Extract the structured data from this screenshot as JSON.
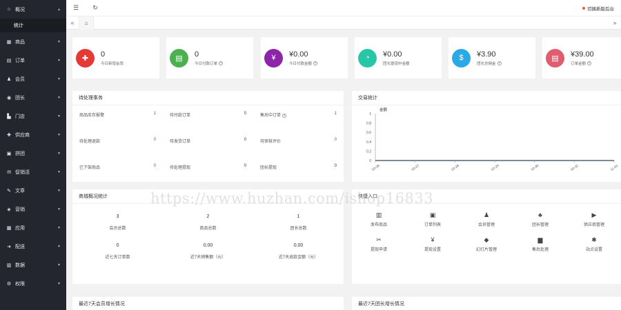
{
  "topbar": {
    "right_text": "切换新版后台"
  },
  "sidebar": {
    "items": [
      {
        "label": "概况",
        "icon": "home-icon",
        "glyph": "⌂",
        "expanded": true
      },
      {
        "label": "统计",
        "sub": true
      },
      {
        "label": "商品",
        "icon": "box-icon",
        "glyph": "▦"
      },
      {
        "label": "订单",
        "icon": "order-icon",
        "glyph": "▤"
      },
      {
        "label": "会员",
        "icon": "user-icon",
        "glyph": "♟"
      },
      {
        "label": "团长",
        "icon": "leader-icon",
        "glyph": "◉"
      },
      {
        "label": "门店",
        "icon": "store-icon",
        "glyph": "▙"
      },
      {
        "label": "供应商",
        "icon": "supplier-icon",
        "glyph": "✚"
      },
      {
        "label": "拼团",
        "icon": "group-icon",
        "glyph": "▣"
      },
      {
        "label": "促销活",
        "icon": "promo-icon",
        "glyph": "✉"
      },
      {
        "label": "文章",
        "icon": "article-icon",
        "glyph": "✎"
      },
      {
        "label": "营销",
        "icon": "marketing-icon",
        "glyph": "◈"
      },
      {
        "label": "应用",
        "icon": "app-icon",
        "glyph": "▩"
      },
      {
        "label": "配送",
        "icon": "delivery-icon",
        "glyph": "➜"
      },
      {
        "label": "数据",
        "icon": "data-icon",
        "glyph": "▥"
      },
      {
        "label": "权限",
        "icon": "permission-icon",
        "glyph": "⚙"
      }
    ]
  },
  "stats": [
    {
      "value": "0",
      "label": "今日新增会员",
      "help": false,
      "color": "#e53935",
      "icon": "user-add-icon",
      "glyph": "✚"
    },
    {
      "value": "0",
      "label": "今日付款订单",
      "help": true,
      "color": "#4caf50",
      "icon": "document-icon",
      "glyph": "▤"
    },
    {
      "value": "¥0.00",
      "label": "今日付款金额",
      "help": true,
      "color": "#8e24aa",
      "icon": "yen-icon",
      "glyph": "¥"
    },
    {
      "value": "¥0.00",
      "label": "团长提现中金额",
      "help": false,
      "color": "#26c6a6",
      "icon": "pie-icon",
      "glyph": "◔"
    },
    {
      "value": "¥3.90",
      "label": "团长总佣金",
      "help": true,
      "color": "#29a9e8",
      "icon": "moneybag-icon",
      "glyph": "$"
    },
    {
      "value": "¥39.00",
      "label": "订单金额",
      "help": true,
      "color": "#e05c6e",
      "icon": "bill-icon",
      "glyph": "▤"
    }
  ],
  "todo": {
    "title": "待处理事务",
    "rows": [
      [
        {
          "label": "商品库存报警",
          "value": "1",
          "blue": true
        },
        {
          "label": "待付款订单",
          "value": "0"
        },
        {
          "label": "售后中订单",
          "value": "1",
          "blue": true,
          "help": true
        }
      ],
      [
        {
          "label": "待处理退款",
          "value": "0",
          "blue": true
        },
        {
          "label": "待发货订单",
          "value": "0"
        },
        {
          "label": "待审核评价",
          "value": "0",
          "blue": true
        }
      ],
      [
        {
          "label": "已下架商品",
          "value": "0",
          "blue": true
        },
        {
          "label": "待处理提现",
          "value": "0"
        },
        {
          "label": "团长提现",
          "value": "0"
        }
      ]
    ]
  },
  "trade": {
    "title": "交易统计",
    "chart_data": {
      "type": "line",
      "series_label": "金额",
      "y_ticks": [
        "1",
        "0.8",
        "0.6",
        "0.4",
        "0.2",
        "0"
      ],
      "ylim": [
        0,
        1
      ],
      "categories": [
        "10-26",
        "10-27",
        "10-28",
        "10-29",
        "10-30",
        "10-31",
        "11-01"
      ],
      "values": [
        0,
        0,
        0,
        0,
        0,
        0,
        0
      ],
      "line_color": "#2f4554"
    }
  },
  "shop": {
    "title": "商城概况统计",
    "rows": [
      [
        {
          "value": "3",
          "label": "会员总数"
        },
        {
          "value": "2",
          "label": "商品总数"
        },
        {
          "value": "1",
          "label": "团长总数"
        }
      ],
      [
        {
          "value": "0",
          "label": "近七天订单数"
        },
        {
          "value": "0.00",
          "label": "近7天销售额（元）"
        },
        {
          "value": "0.00",
          "label": "近7天退款金额（元）"
        }
      ]
    ]
  },
  "quick": {
    "title": "快捷入口",
    "rows": [
      [
        {
          "label": "发布商品",
          "icon": "barcode-icon",
          "glyph": "▥"
        },
        {
          "label": "订单列表",
          "icon": "clipboard-icon",
          "glyph": "▣"
        },
        {
          "label": "会员管理",
          "icon": "user-manage-icon",
          "glyph": "♟"
        },
        {
          "label": "团长管理",
          "icon": "org-icon",
          "glyph": "♣"
        },
        {
          "label": "供应商管理",
          "icon": "truck-icon",
          "glyph": "▶"
        }
      ],
      [
        {
          "label": "提现申请",
          "icon": "ticket-icon",
          "glyph": "✂"
        },
        {
          "label": "提现设置",
          "icon": "coin-icon",
          "glyph": "¥"
        },
        {
          "label": "幻灯片管理",
          "icon": "tag-icon",
          "glyph": "◆"
        },
        {
          "label": "售后处理",
          "icon": "chart-bars-icon",
          "glyph": "▆"
        },
        {
          "label": "站点设置",
          "icon": "settings-icon",
          "glyph": "✱"
        }
      ]
    ]
  },
  "bottom_panels": [
    {
      "title": "最近7天会员增长情况"
    },
    {
      "title": "最近7天团长增长情况"
    }
  ],
  "watermark": "https://www.huzhan.com/ishop16833"
}
